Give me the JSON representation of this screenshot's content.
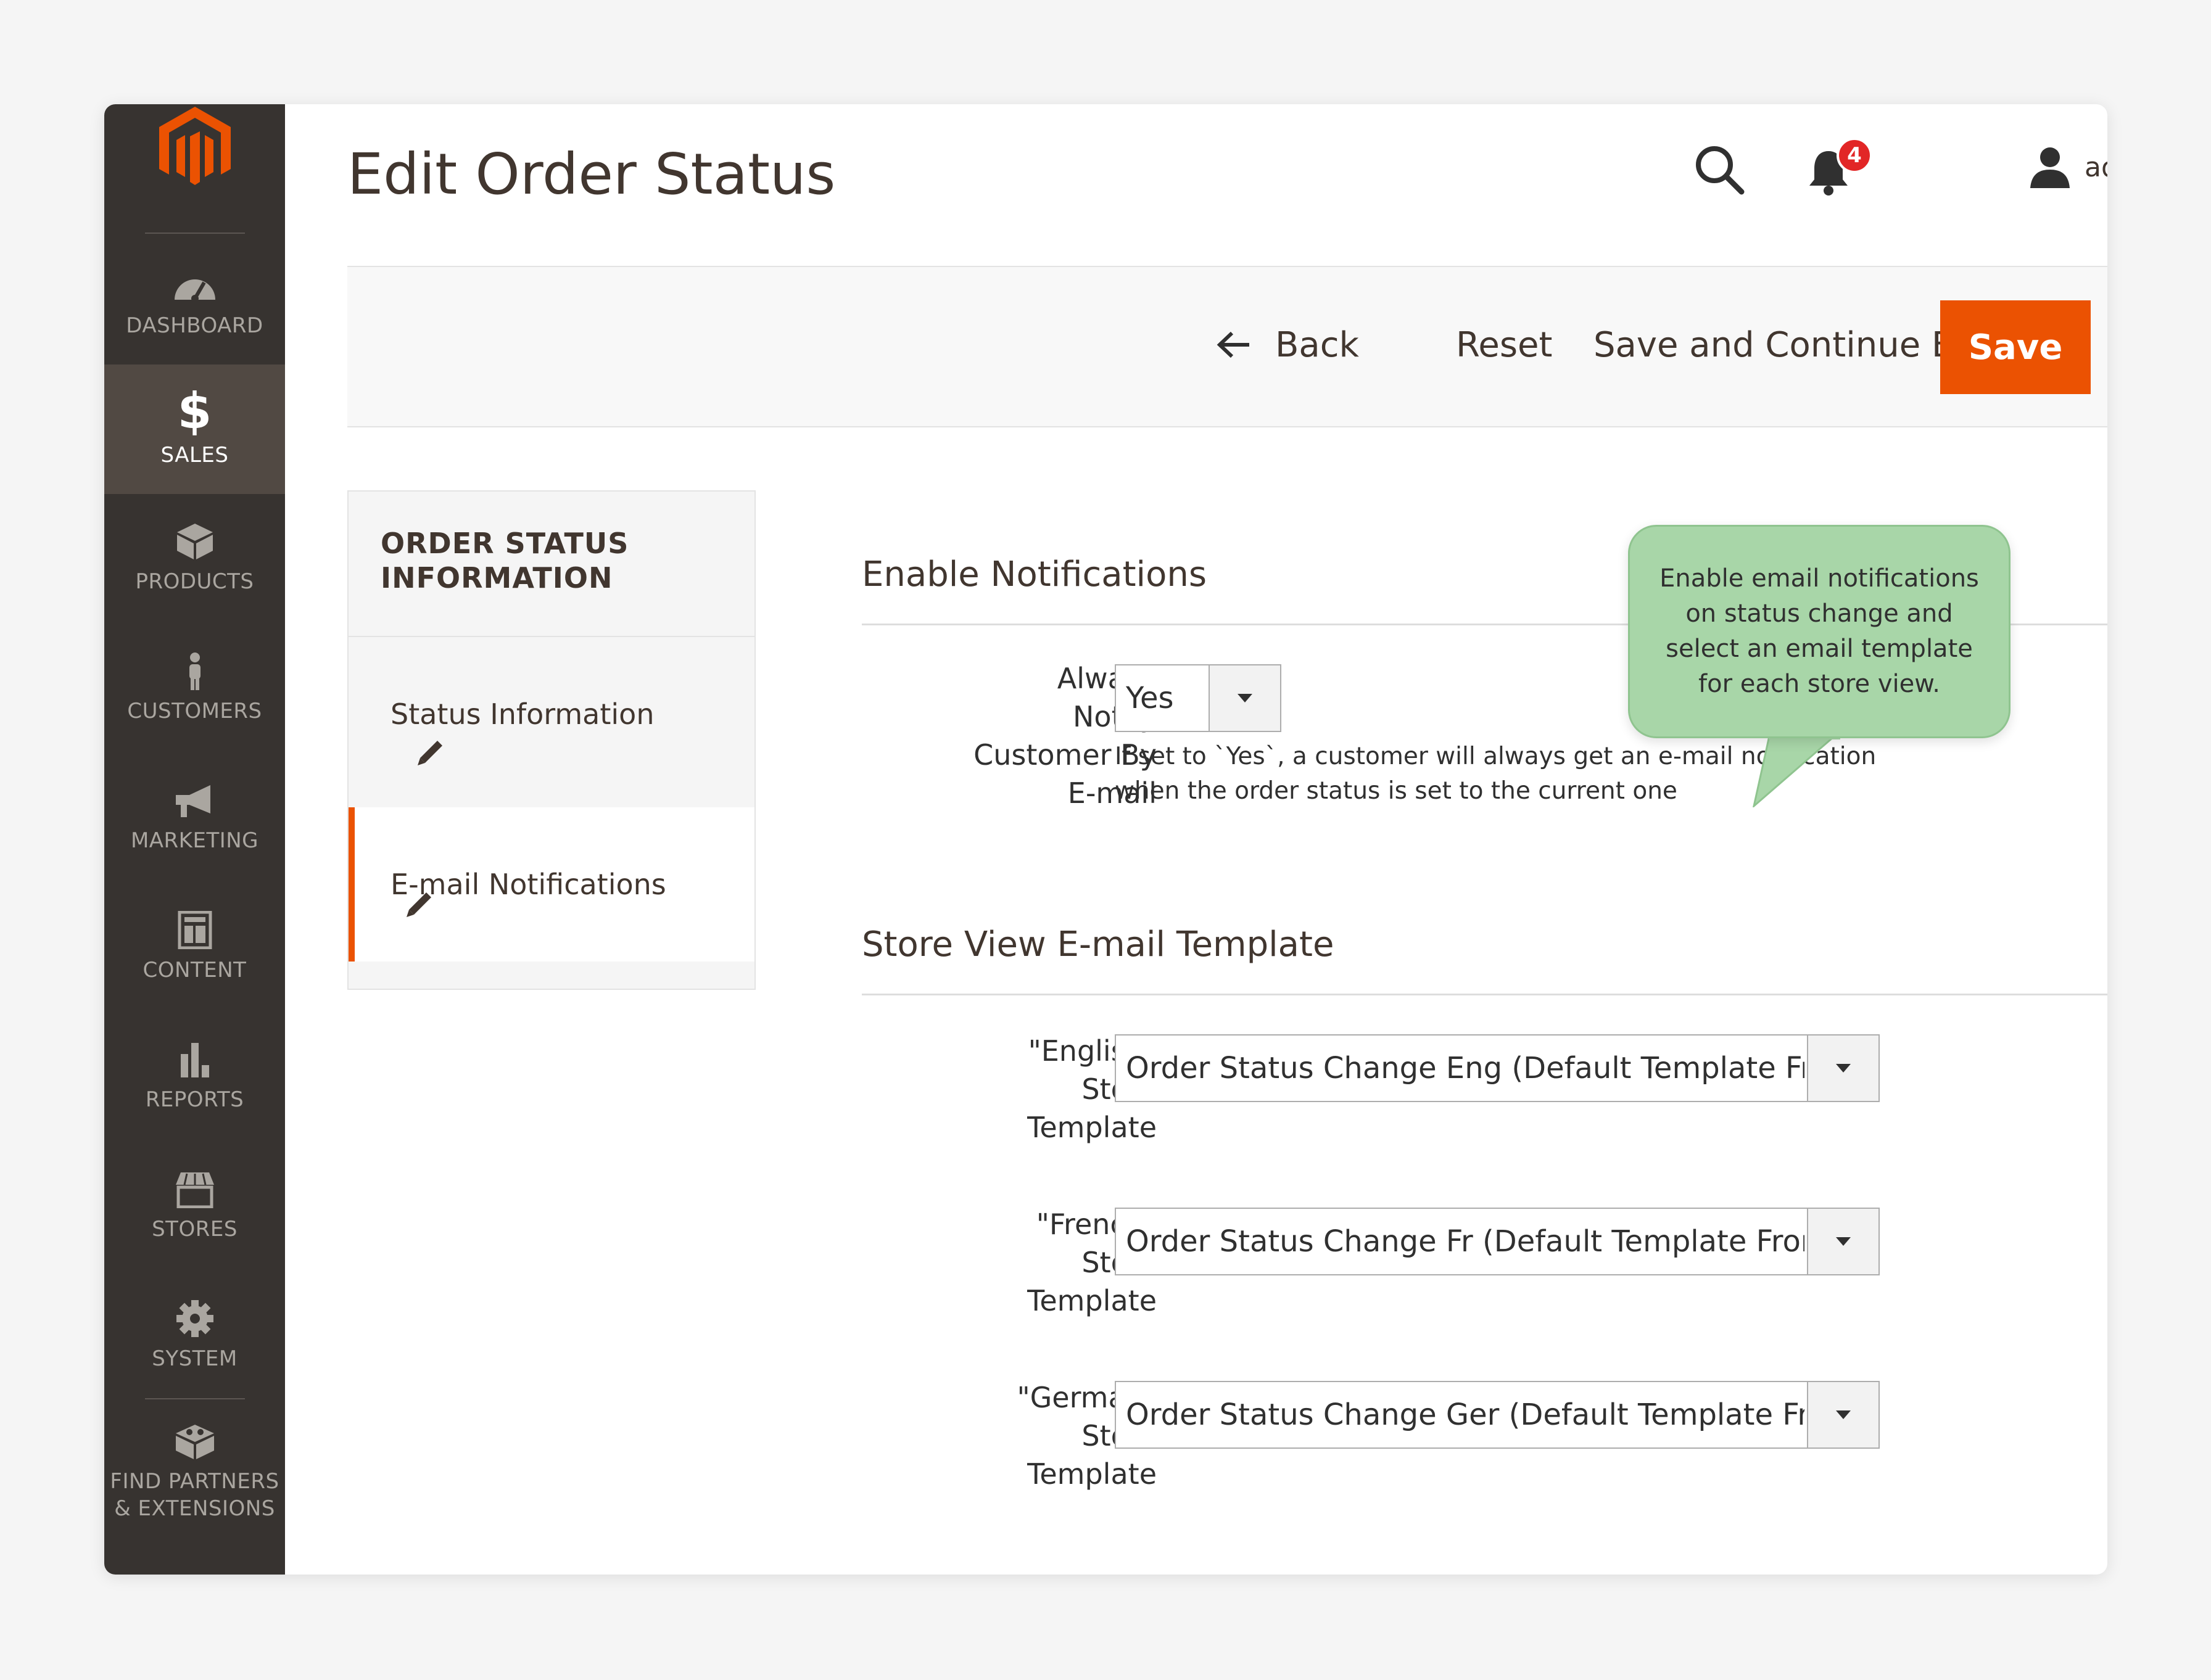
{
  "sidebar": {
    "items": [
      {
        "label": "DASHBOARD",
        "icon": "dashboard-icon"
      },
      {
        "label": "SALES",
        "icon": "dollar-icon",
        "glyph": "$"
      },
      {
        "label": "PRODUCTS",
        "icon": "box-icon"
      },
      {
        "label": "CUSTOMERS",
        "icon": "person-icon"
      },
      {
        "label": "MARKETING",
        "icon": "megaphone-icon"
      },
      {
        "label": "CONTENT",
        "icon": "layout-icon"
      },
      {
        "label": "REPORTS",
        "icon": "bar-chart-icon"
      },
      {
        "label": "STORES",
        "icon": "storefront-icon"
      },
      {
        "label": "SYSTEM",
        "icon": "gear-icon"
      },
      {
        "label_line1": "FIND PARTNERS",
        "label_line2": "& EXTENSIONS",
        "icon": "blocks-icon"
      }
    ]
  },
  "header": {
    "title": "Edit Order Status",
    "notification_count": "4",
    "user_name": "admin"
  },
  "actions": {
    "back": "Back",
    "reset": "Reset",
    "save_continue": "Save and Continue Edit",
    "save": "Save"
  },
  "tabs": {
    "title": "ORDER STATUS INFORMATION",
    "items": [
      {
        "label": "Status Information"
      },
      {
        "label": "E-mail Notifications"
      }
    ]
  },
  "notifications": {
    "section_title": "Enable Notifications",
    "always_notify_label_lines": [
      "Always",
      "Notify",
      "Customer By",
      "E-mail"
    ],
    "always_notify_value": "Yes",
    "note_line1": "If set to `Yes`, a customer will always get an e-mail notification",
    "note_line2": "when the order status is set to the current one"
  },
  "templates": {
    "section_title": "Store View E-mail Template",
    "rows": [
      {
        "label_lines": [
          "\"English\"",
          "Store",
          "Template"
        ],
        "value": "Order Status Change Eng (Default Template From"
      },
      {
        "label_lines": [
          "\"French\"",
          "Store",
          "Template"
        ],
        "value": "Order Status Change Fr (Default Template From I"
      },
      {
        "label_lines": [
          "\"German\"",
          "Store",
          "Template"
        ],
        "value": "Order Status Change Ger (Default Template From"
      }
    ]
  },
  "callout": {
    "text": "Enable email notifications on status change and select an email template for each store view."
  },
  "colors": {
    "accent": "#eb5202",
    "sidebar_bg": "#373330",
    "sidebar_active": "#514943",
    "callout_bg": "#a8d6a8"
  }
}
